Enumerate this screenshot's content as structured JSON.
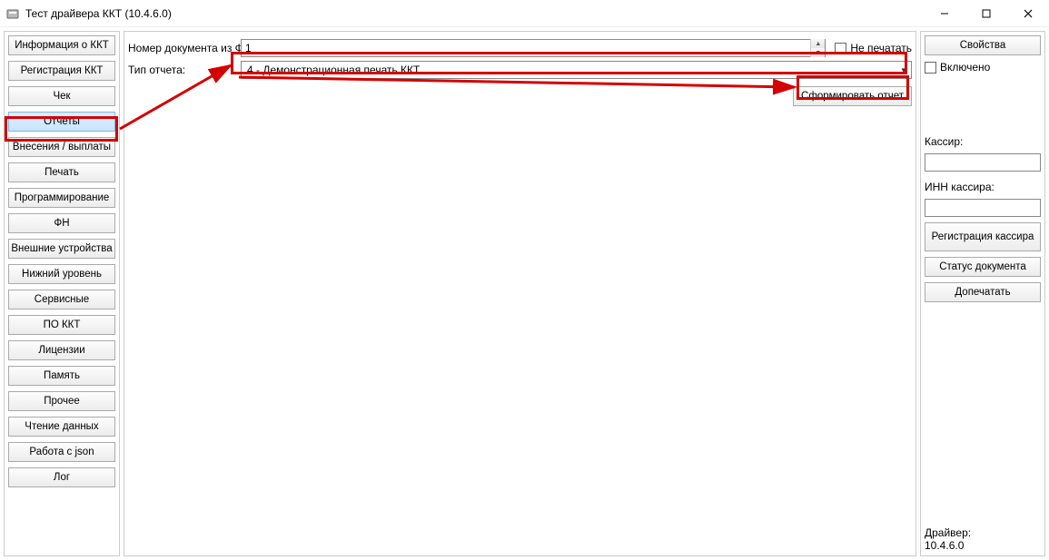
{
  "window": {
    "title": "Тест драйвера ККТ (10.4.6.0)",
    "controls": {
      "min": "—",
      "max": "☐",
      "close": "✕"
    }
  },
  "nav": {
    "items": [
      "Информация о ККТ",
      "Регистрация ККТ",
      "Чек",
      "Отчеты",
      "Внесения / выплаты",
      "Печать",
      "Программирование",
      "ФН",
      "Внешние устройства",
      "Нижний уровень",
      "Сервисные",
      "ПО ККТ",
      "Лицензии",
      "Память",
      "Прочее",
      "Чтение данных",
      "Работа с json",
      "Лог"
    ],
    "selected_index": 3
  },
  "main": {
    "doc_num_label": "Номер документа из ФН:",
    "doc_num_value": "1",
    "no_print_label": "Не печатать",
    "no_print_checked": false,
    "report_type_label": "Тип отчета:",
    "report_type_selected": "4 - Демонстрационная печать ККТ",
    "generate_report_label": "Сформировать отчет"
  },
  "right": {
    "properties_label": "Свойства",
    "enabled_label": "Включено",
    "enabled_checked": false,
    "cashier_label": "Кассир:",
    "cashier_value": "",
    "cashier_inn_label": "ИНН кассира:",
    "cashier_inn_value": "",
    "register_cashier_label": "Регистрация кассира",
    "doc_status_label": "Статус документа",
    "doprint_label": "Допечатать",
    "driver_label": "Драйвер:",
    "driver_version": "10.4.6.0"
  }
}
